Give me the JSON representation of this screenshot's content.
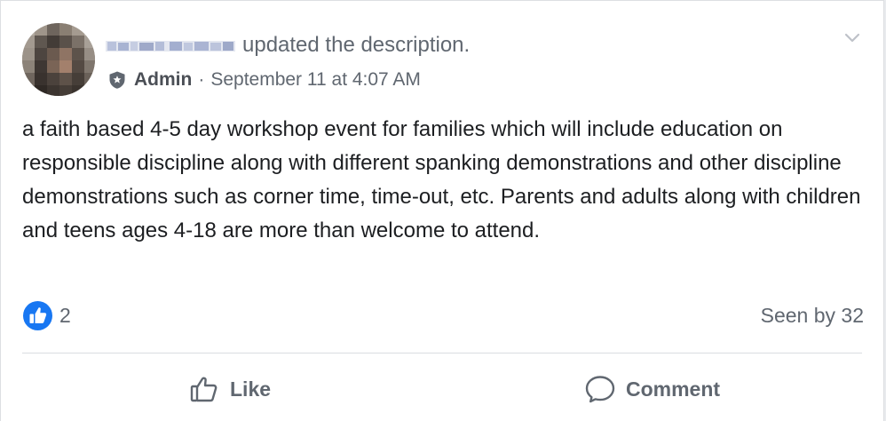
{
  "post": {
    "author_redacted": true,
    "action_text": "updated the description.",
    "role": "Admin",
    "separator": "·",
    "timestamp": "September 11 at 4:07 AM",
    "body": "a faith based 4-5 day workshop event for families which will include education on responsible discipline along with different spanking demonstrations and other discipline demonstrations such as corner time, time-out, etc. Parents and adults along with children and teens ages 4-18 are more than welcome to attend."
  },
  "reactions": {
    "count": "2",
    "seen_by": "Seen by 32"
  },
  "actions": {
    "like_label": "Like",
    "comment_label": "Comment"
  },
  "colors": {
    "like_blue": "#1877f2",
    "secondary_text": "#606770",
    "primary_text": "#1c1e21"
  },
  "icons": {
    "admin": "shield-star-icon",
    "menu": "chevron-down-icon",
    "reaction": "thumbs-up-icon",
    "like_action": "thumbs-up-outline-icon",
    "comment_action": "comment-bubble-icon"
  }
}
